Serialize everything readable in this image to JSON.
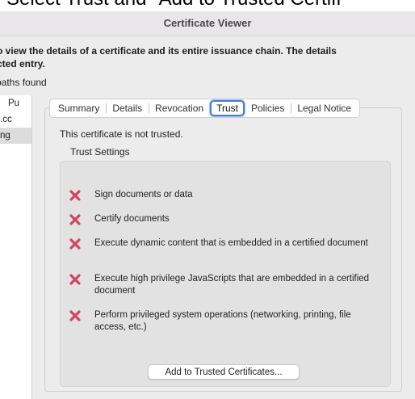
{
  "caption": "Select Trust and \"Add to Trusted Certifi",
  "window": {
    "title": "Certificate Viewer"
  },
  "description": {
    "line1": "o view the details of a certificate and its entire issuance chain. The details",
    "line2": "cted entry."
  },
  "paths_label": "paths found",
  "left_list": {
    "items": [
      "Pu",
      ".cc",
      "ng"
    ]
  },
  "tabs": [
    {
      "label": "Summary"
    },
    {
      "label": "Details"
    },
    {
      "label": "Revocation"
    },
    {
      "label": "Trust",
      "active": true
    },
    {
      "label": "Policies"
    },
    {
      "label": "Legal Notice"
    }
  ],
  "trust": {
    "status": "This certificate is not trusted.",
    "settings_label": "Trust Settings",
    "permissions": [
      {
        "label": "Sign documents or data",
        "icon": "x-icon"
      },
      {
        "label": "Certify documents",
        "icon": "x-icon"
      },
      {
        "label": "Execute dynamic content that is embedded in a certified document",
        "icon": "x-icon"
      },
      {
        "label": "Execute high privilege JavaScripts that are embedded in a certified document",
        "icon": "x-icon"
      },
      {
        "label": "Perform privileged system operations (networking, printing, file access, etc.)",
        "icon": "x-icon"
      }
    ],
    "add_button": "Add to Trusted Certificates..."
  },
  "colors": {
    "deny_icon": "#d2455c",
    "active_tab_ring": "#3f7fe0"
  }
}
